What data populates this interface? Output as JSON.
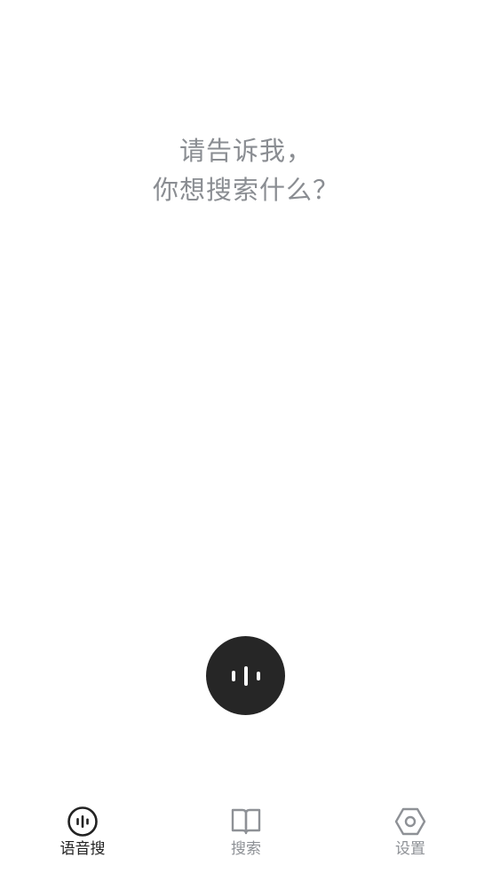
{
  "prompt": {
    "line1": "请告诉我，",
    "line2": "你想搜索什么？"
  },
  "mic_button": {
    "icon": "voice-wave-icon"
  },
  "tabbar": {
    "tabs": [
      {
        "label": "语音搜",
        "icon": "voice-wave-icon",
        "active": true
      },
      {
        "label": "搜索",
        "icon": "book-icon",
        "active": false
      },
      {
        "label": "设置",
        "icon": "hexagon-settings-icon",
        "active": false
      }
    ]
  },
  "colors": {
    "prompt_text": "#8a8d92",
    "mic_button_bg": "#262626",
    "tab_active": "#222222",
    "tab_inactive": "#8e9196"
  }
}
